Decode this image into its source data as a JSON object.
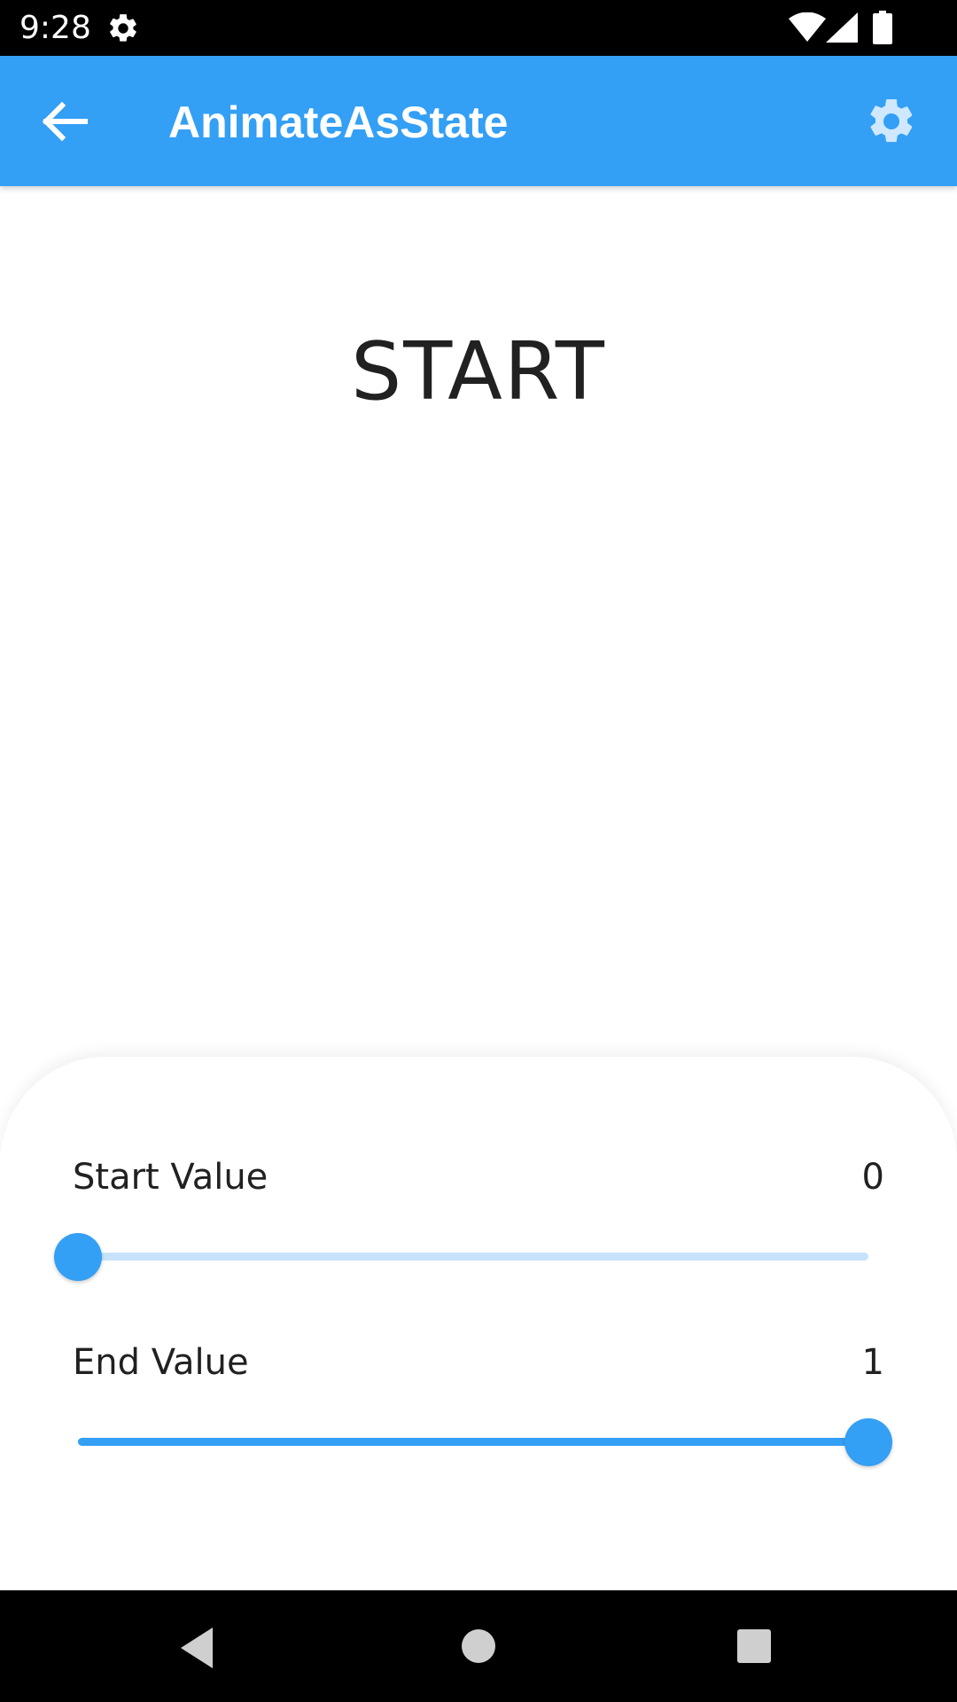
{
  "status_bar": {
    "time": "9:28",
    "icons": [
      "gear-icon",
      "wifi-icon",
      "signal-icon",
      "battery-icon"
    ]
  },
  "app_bar": {
    "title": "AnimateAsState",
    "back_icon": "arrow-back-icon",
    "settings_icon": "gear-icon",
    "background_color": "#339ff5"
  },
  "content": {
    "state_label": "START"
  },
  "sheet": {
    "start": {
      "label": "Start Value",
      "value": "0",
      "slider_level": 0
    },
    "end": {
      "label": "End Value",
      "value": "1",
      "slider_level": 1
    }
  },
  "nav_bar": {
    "icons": [
      "back-triangle-icon",
      "home-circle-icon",
      "recents-square-icon"
    ]
  },
  "colors": {
    "accent": "#339ff5",
    "track_inactive": "#c6e3fb",
    "text": "#212121"
  }
}
